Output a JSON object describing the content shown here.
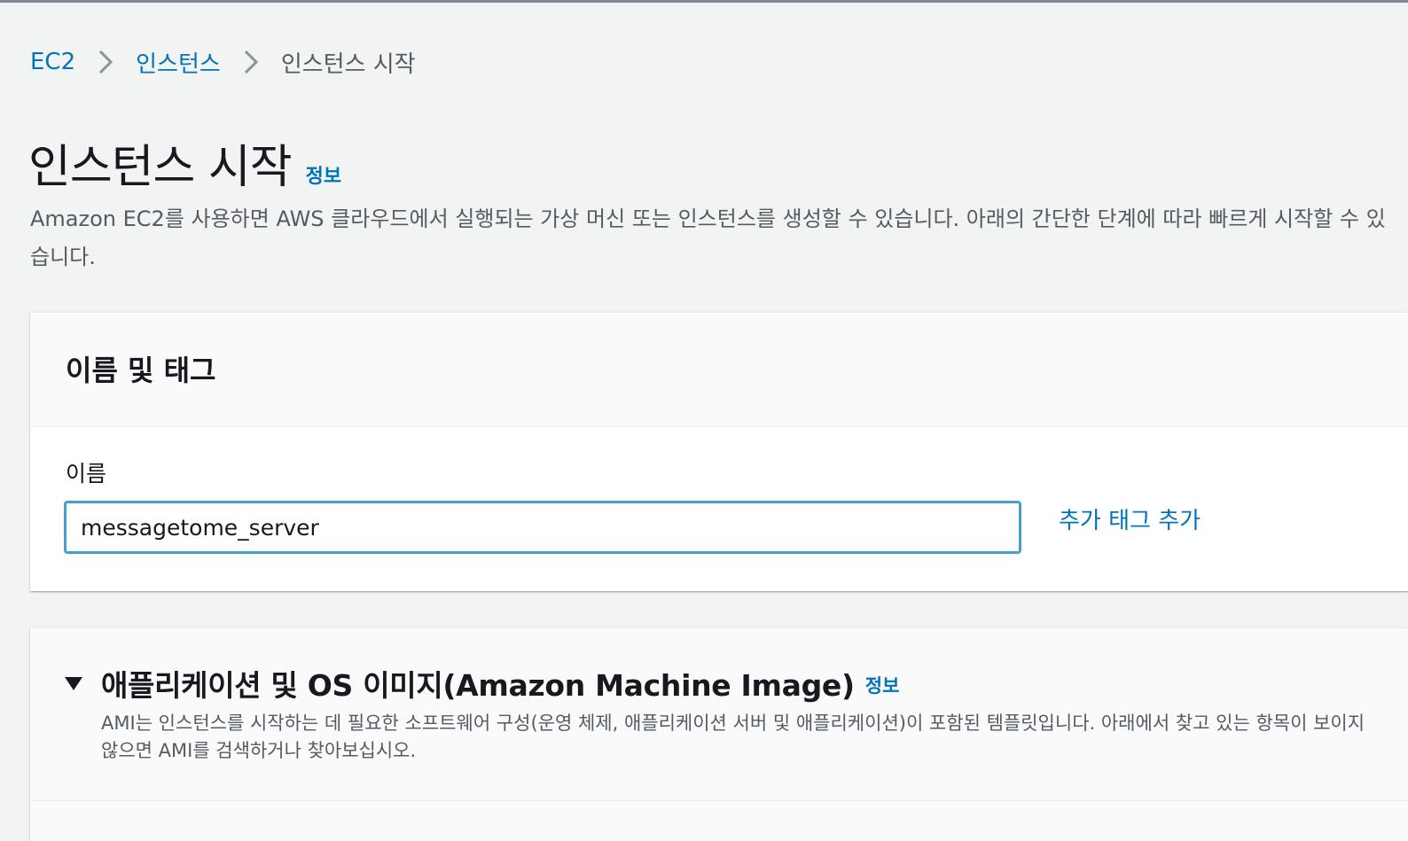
{
  "breadcrumb": {
    "items": [
      "EC2",
      "인스턴스"
    ],
    "current": "인스턴스 시작"
  },
  "page": {
    "title": "인스턴스 시작",
    "info_link": "정보",
    "description": "Amazon EC2를 사용하면 AWS 클라우드에서 실행되는 가상 머신 또는 인스턴스를 생성할 수 있습니다. 아래의 간단한 단계에 따라 빠르게 시작할 수 있습니다."
  },
  "name_tags_panel": {
    "title": "이름 및 태그",
    "name_label": "이름",
    "name_value": "messagetome_server",
    "add_tag_link": "추가 태그 추가"
  },
  "ami_panel": {
    "title": "애플리케이션 및 OS 이미지(Amazon Machine Image)",
    "info_link": "정보",
    "description": "AMI는 인스턴스를 시작하는 데 필요한 소프트웨어 구성(운영 체제, 애플리케이션 서버 및 애플리케이션)이 포함된 템플릿입니다. 아래에서 찾고 있는 항목이 보이지 않으면 AMI를 검색하거나 찾아보십시오."
  },
  "colors": {
    "link": "#0073bb",
    "input_focus_border": "#44a0cf",
    "background": "#f2f3f3"
  }
}
